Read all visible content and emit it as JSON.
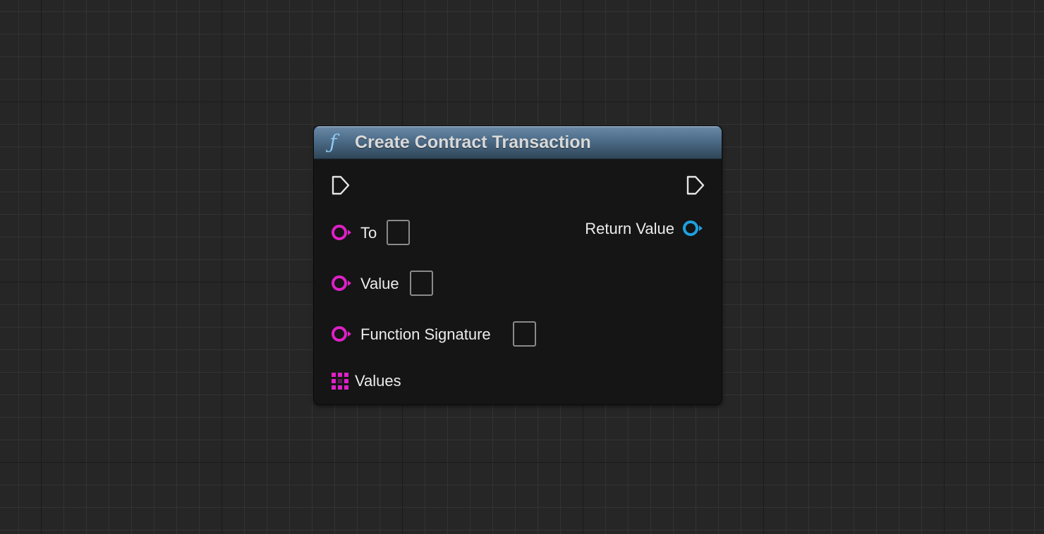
{
  "canvas": {
    "background_color": "#262626",
    "grid_minor_color": "#333333",
    "grid_major_color": "#1b1b1b"
  },
  "node": {
    "title": "Create Contract Transaction",
    "title_icon": "function-icon",
    "title_icon_glyph": "ƒ",
    "header_color": "#4f6f8c",
    "body_color": "#141514",
    "exec_input_icon": "exec-pin-icon",
    "exec_output_icon": "exec-pin-icon",
    "inputs": [
      {
        "label": "To",
        "pin_color": "#e020c8",
        "value": ""
      },
      {
        "label": "Value",
        "pin_color": "#e020c8",
        "value": ""
      },
      {
        "label": "Function Signature",
        "pin_color": "#e020c8",
        "value": ""
      },
      {
        "label": "Values",
        "pin_color": "#e020c8",
        "pin_type": "array-grid-icon"
      }
    ],
    "outputs": [
      {
        "label": "Return Value",
        "pin_color": "#1fa0e0"
      }
    ]
  }
}
